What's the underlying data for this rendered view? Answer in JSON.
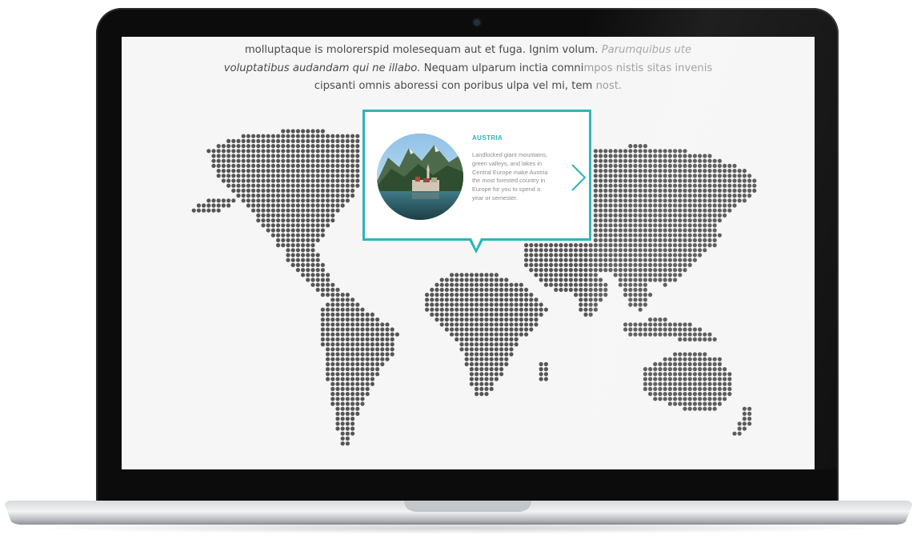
{
  "intro": {
    "line1": "molluptaque is molorerspid molesequam aut et fuga. Ignim volum.",
    "line1_italic": "Parumquibus ute",
    "line2_italic": "voluptatibus audandam qui ne illabo.",
    "line2": "Nequam ulparum inctia comni",
    "line2_fade": "mpos nistis sitas invenis",
    "line3": "cipsanti omnis aboressi con poribus ulpa vel mi, tem",
    "line3_fade": "nost."
  },
  "popup": {
    "country": "AUSTRIA",
    "description": "Landlocked giant mountains, green valleys, and lakes in Central Europe make Austria the most forested country in Europe for you to spend a year or semester.",
    "next_icon": "chevron-right-icon",
    "image_icon": "landscape-photo-icon"
  },
  "colors": {
    "accent": "#2bb5b8",
    "map_dot": "#555555",
    "body_text": "#4a4a4a",
    "screen_bg": "#f6f6f6"
  }
}
